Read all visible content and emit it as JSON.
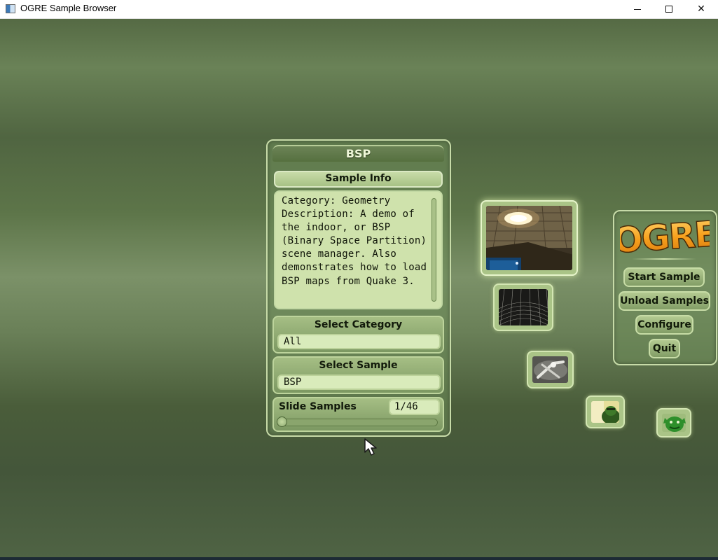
{
  "window": {
    "title": "OGRE Sample Browser",
    "minimize_glyph": "",
    "maximize_glyph": "",
    "close_glyph": "✕"
  },
  "sample_panel": {
    "title": "BSP",
    "info_header": "Sample Info",
    "info_text": "Category: Geometry\nDescription: A demo of the indoor, or BSP (Binary Space Partition) scene manager. Also demonstrates how to load BSP maps from Quake 3.",
    "select_category_label": "Select Category",
    "select_category_value": "All",
    "select_sample_label": "Select Sample",
    "select_sample_value": "BSP",
    "slide_samples_label": "Slide Samples",
    "slide_samples_value": "1/46",
    "slider_position": 0.0
  },
  "thumbnails": [
    {
      "name": "bsp-thumbnail",
      "icon": "bsp-room-ceiling-light",
      "selected": true
    },
    {
      "name": "wireframe-thumbnail",
      "icon": "wireframe-grid"
    },
    {
      "name": "bones-thumbnail",
      "icon": "bones-xray"
    },
    {
      "name": "character-thumbnail",
      "icon": "green-character"
    },
    {
      "name": "ogre-head-thumbnail",
      "icon": "green-ogre-head"
    }
  ],
  "menu": {
    "logo_text": "OGRE",
    "start_sample": "Start Sample",
    "unload_samples": "Unload Samples",
    "configure": "Configure",
    "quit": "Quit"
  },
  "colors": {
    "panel_border": "#c7dba8",
    "field_bg": "#d9ebbb",
    "title_text": "#eef6d8",
    "logo_orange": "#f39a1e"
  }
}
